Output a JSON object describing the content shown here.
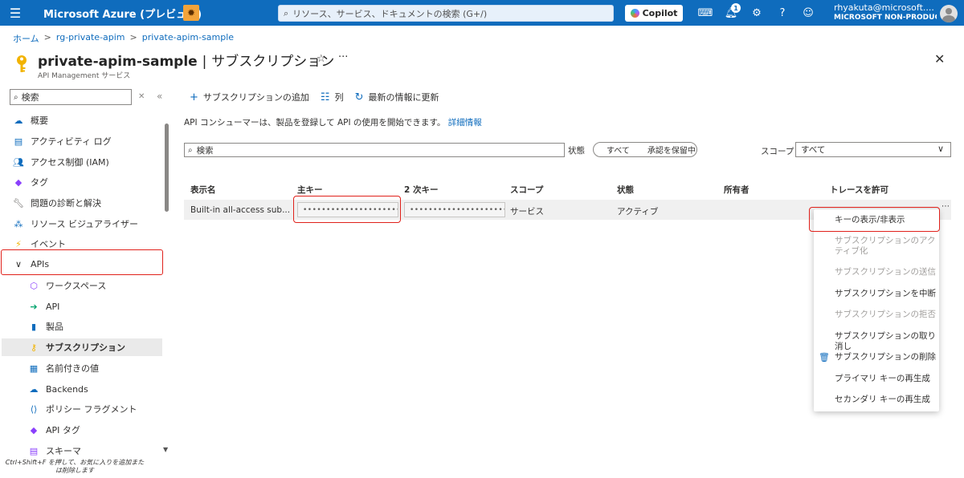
{
  "topbar": {
    "brand": "Microsoft Azure (プレビュー)",
    "search_placeholder": "リソース、サービス、ドキュメントの検索 (G+/)",
    "copilot_label": "Copilot",
    "notification_count": "1",
    "user_name": "rhyakuta@microsoft....",
    "user_tenant": "MICROSOFT NON-PRODUC..."
  },
  "breadcrumb": [
    "ホーム",
    "rg-private-apim",
    "private-apim-sample"
  ],
  "header": {
    "title_resource": "private-apim-sample",
    "title_separator": "|",
    "title_section": "サブスクリプション",
    "subtitle": "API Management サービス"
  },
  "sidebar": {
    "search_value": "検索",
    "items": [
      {
        "label": "概要",
        "icon": "cloud-icon"
      },
      {
        "label": "アクティビティ ログ",
        "icon": "log-icon"
      },
      {
        "label": "アクセス制御 (IAM)",
        "icon": "people-icon"
      },
      {
        "label": "タグ",
        "icon": "tag-icon"
      },
      {
        "label": "問題の診断と解決",
        "icon": "wrench-icon"
      },
      {
        "label": "リソース ビジュアライザー",
        "icon": "visualizer-icon"
      },
      {
        "label": "イベント",
        "icon": "lightning-icon"
      },
      {
        "label": "APIs",
        "icon": "chevron-down-icon"
      },
      {
        "label": "ワークスペース",
        "icon": "workspace-icon"
      },
      {
        "label": "API",
        "icon": "api-icon"
      },
      {
        "label": "製品",
        "icon": "product-icon"
      },
      {
        "label": "サブスクリプション",
        "icon": "key-icon"
      },
      {
        "label": "名前付きの値",
        "icon": "table-icon"
      },
      {
        "label": "Backends",
        "icon": "cloud-backend-icon"
      },
      {
        "label": "ポリシー フラグメント",
        "icon": "fragment-icon"
      },
      {
        "label": "API タグ",
        "icon": "tag-icon"
      },
      {
        "label": "スキーマ",
        "icon": "schema-icon"
      }
    ],
    "hint": "Ctrl+Shift+F を押して、お気に入りを追加または削除します"
  },
  "toolbar": {
    "add_label": "サブスクリプションの追加",
    "columns_label": "列",
    "refresh_label": "最新の情報に更新"
  },
  "info": {
    "text": "API コンシューマーは、製品を登録して API の使用を開始できます。",
    "link": "詳細情報"
  },
  "filters": {
    "search_placeholder": "検索",
    "status_label": "状態",
    "status_options": [
      "すべて",
      "承認を保留中"
    ],
    "scope_label": "スコープ",
    "scope_value": "すべて"
  },
  "table": {
    "columns": [
      "表示名",
      "主キー",
      "2 次キー",
      "スコープ",
      "状態",
      "所有者",
      "トレースを許可"
    ],
    "rows": [
      {
        "display_name": "Built-in all-access sub...",
        "primary_key": "••••••••••••••••••••••...",
        "secondary_key": "••••••••••••••••••••••...",
        "scope": "サービス",
        "status": "アクティブ",
        "owner": "",
        "trace": ""
      }
    ]
  },
  "context_menu": {
    "items": [
      {
        "label": "キーの表示/非表示",
        "disabled": false
      },
      {
        "label": "サブスクリプションのアクティブ化",
        "disabled": true
      },
      {
        "label": "サブスクリプションの送信",
        "disabled": true
      },
      {
        "label": "サブスクリプションを中断",
        "disabled": false
      },
      {
        "label": "サブスクリプションの拒否",
        "disabled": true
      },
      {
        "label": "サブスクリプションの取り消し",
        "disabled": false
      },
      {
        "label": "サブスクリプションの削除",
        "disabled": false
      },
      {
        "label": "プライマリ キーの再生成",
        "disabled": false
      },
      {
        "label": "セカンダリ キーの再生成",
        "disabled": false
      }
    ]
  },
  "colors": {
    "accent": "#0f6cbd",
    "highlight": "#e0211b",
    "key_gold": "#f2b300"
  }
}
